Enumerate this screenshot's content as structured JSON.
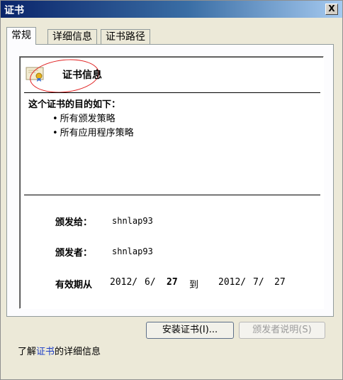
{
  "window": {
    "title": "证书",
    "close_label": "X"
  },
  "tabs": [
    {
      "label": "常规",
      "active": true
    },
    {
      "label": "详细信息",
      "active": false
    },
    {
      "label": "证书路径",
      "active": false
    }
  ],
  "cert": {
    "info_title": "证书信息",
    "purpose_heading": "这个证书的目的如下：",
    "purposes": [
      "所有颁发策略",
      "所有应用程序策略"
    ],
    "issued_to_label": "颁发给：",
    "issued_to_value": "shnlap93",
    "issued_by_label": "颁发者：",
    "issued_by_value": "shnlap93",
    "validity_label": "有效期从",
    "valid_from": {
      "year": "2012/",
      "month": "6/",
      "day": "27"
    },
    "to_label": "到",
    "valid_to": {
      "year": "2012/",
      "month": "7/",
      "day": "27"
    }
  },
  "buttons": {
    "install_label": "安装证书(I)...",
    "issuer_statement_label": "颁发者说明(S)"
  },
  "footer": {
    "prefix": "了解",
    "link": "证书",
    "suffix": "的详细信息"
  },
  "colors": {
    "annotation_circle": "#e02020",
    "link": "#1f3fc6",
    "dialog_bg": "#ece9d8"
  }
}
